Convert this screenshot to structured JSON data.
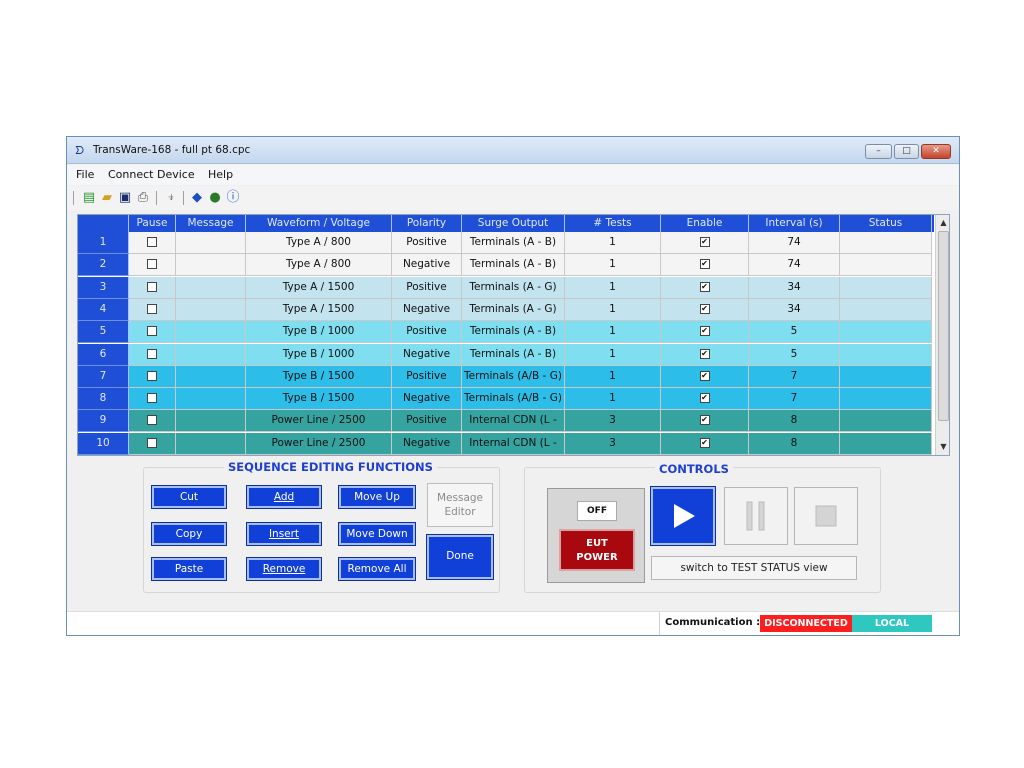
{
  "window": {
    "title": "TransWare-168 - full pt 68.cpc",
    "controls": {
      "minimize": "–",
      "maximize": "□",
      "close": "✕"
    }
  },
  "menu": [
    "File",
    "Connect Device",
    "Help"
  ],
  "toolbar_icons": [
    "new-file-icon",
    "open-folder-icon",
    "save-icon",
    "print-icon",
    "connect-plug-icon",
    "update-icon",
    "globe-icon",
    "info-icon"
  ],
  "grid": {
    "headers": [
      "",
      "Pause",
      "Message",
      "Waveform / Voltage",
      "Polarity",
      "Surge Output",
      "# Tests",
      "Enable",
      "Interval (s)",
      "Status"
    ],
    "rows": [
      {
        "num": "1",
        "pause": "",
        "message": "",
        "waveform": "Type A / 800",
        "polarity": "Positive",
        "output": "Terminals (A - B)",
        "tests": "1",
        "enable": "✔",
        "interval": "74",
        "status": "",
        "color": "#f4f4f4"
      },
      {
        "num": "2",
        "pause": "",
        "message": "",
        "waveform": "Type A / 800",
        "polarity": "Negative",
        "output": "Terminals (A - B)",
        "tests": "1",
        "enable": "✔",
        "interval": "74",
        "status": "",
        "color": "#f4f4f4"
      },
      {
        "num": "3",
        "pause": "",
        "message": "",
        "waveform": "Type A / 1500",
        "polarity": "Positive",
        "output": "Terminals (A - G)",
        "tests": "1",
        "enable": "✔",
        "interval": "34",
        "status": "",
        "color": "#c3e3ef"
      },
      {
        "num": "4",
        "pause": "",
        "message": "",
        "waveform": "Type A / 1500",
        "polarity": "Negative",
        "output": "Terminals (A - G)",
        "tests": "1",
        "enable": "✔",
        "interval": "34",
        "status": "",
        "color": "#c3e3ef"
      },
      {
        "num": "5",
        "pause": "",
        "message": "",
        "waveform": "Type B / 1000",
        "polarity": "Positive",
        "output": "Terminals (A - B)",
        "tests": "1",
        "enable": "✔",
        "interval": "5",
        "status": "",
        "color": "#7fdff1"
      },
      {
        "num": "6",
        "pause": "",
        "message": "",
        "waveform": "Type B / 1000",
        "polarity": "Negative",
        "output": "Terminals (A - B)",
        "tests": "1",
        "enable": "✔",
        "interval": "5",
        "status": "",
        "color": "#7fdff1"
      },
      {
        "num": "7",
        "pause": "",
        "message": "",
        "waveform": "Type B / 1500",
        "polarity": "Positive",
        "output": "Terminals (A/B - G)",
        "tests": "1",
        "enable": "✔",
        "interval": "7",
        "status": "",
        "color": "#2cbde9"
      },
      {
        "num": "8",
        "pause": "",
        "message": "",
        "waveform": "Type B / 1500",
        "polarity": "Negative",
        "output": "Terminals (A/B - G)",
        "tests": "1",
        "enable": "✔",
        "interval": "7",
        "status": "",
        "color": "#2cbde9"
      },
      {
        "num": "9",
        "pause": "",
        "message": "",
        "waveform": "Power Line / 2500",
        "polarity": "Positive",
        "output": "Internal CDN (L - N)",
        "tests": "3",
        "enable": "✔",
        "interval": "8",
        "status": "",
        "color": "#35a3a0"
      },
      {
        "num": "10",
        "pause": "",
        "message": "",
        "waveform": "Power Line / 2500",
        "polarity": "Negative",
        "output": "Internal CDN (L - N)",
        "tests": "3",
        "enable": "✔",
        "interval": "8",
        "status": "",
        "color": "#35a3a0"
      }
    ]
  },
  "editing": {
    "title": "SEQUENCE EDITING FUNCTIONS",
    "cut": "Cut",
    "add": "Add",
    "move_up": "Move Up",
    "copy": "Copy",
    "insert": "Insert",
    "move_down": "Move Down",
    "paste": "Paste",
    "remove": "Remove",
    "remove_all": "Remove All",
    "message_editor_1": "Message",
    "message_editor_2": "Editor",
    "done": "Done"
  },
  "controls": {
    "title": "CONTROLS",
    "power_state": "OFF",
    "eut_1": "EUT",
    "eut_2": "POWER",
    "switch_view": "switch to TEST STATUS view"
  },
  "status": {
    "label": "Communication :",
    "connection": "DISCONNECTED",
    "connection_color": "#ff1e1e",
    "mode": "LOCAL",
    "mode_color": "#2ec8c0"
  }
}
